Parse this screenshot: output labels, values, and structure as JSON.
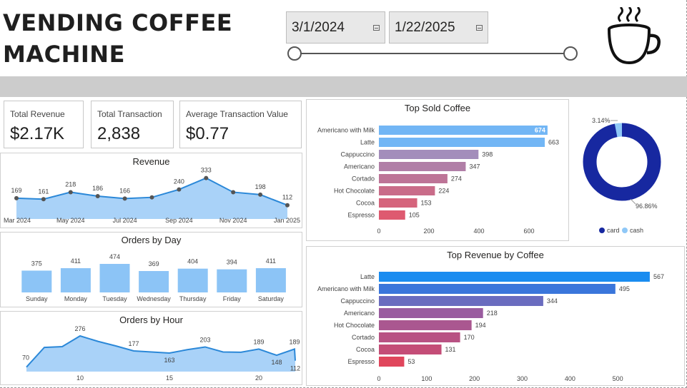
{
  "header": {
    "title_line1": "VENDING COFFEE",
    "title_line2": "MACHINE",
    "date_start": "3/1/2024",
    "date_end": "1/22/2025",
    "icon": "coffee-cup-icon"
  },
  "kpis": {
    "total_revenue_label": "Total Revenue",
    "total_revenue_value": "$2.17K",
    "total_transaction_label": "Total Transaction",
    "total_transaction_value": "2,838",
    "avg_transaction_label": "Average Transaction Value",
    "avg_transaction_value": "$0.77"
  },
  "colors": {
    "area_fill": "#a9d2f8",
    "area_line": "#2b88d8",
    "bar_light": "#8cc4f6",
    "donut_card": "#1728a0",
    "donut_cash": "#8fc8f7"
  },
  "chart_data": [
    {
      "id": "revenue",
      "type": "area",
      "title": "Revenue",
      "x": [
        "Mar 2024",
        "Apr 2024",
        "May 2024",
        "Jun 2024",
        "Jul 2024",
        "Aug 2024",
        "Sep 2024",
        "Oct 2024",
        "Nov 2024",
        "Dec 2024",
        "Jan 2025"
      ],
      "values": [
        169,
        161,
        218,
        186,
        166,
        176,
        240,
        333,
        218,
        198,
        112
      ],
      "data_labels": [
        169,
        161,
        218,
        186,
        166,
        null,
        240,
        333,
        null,
        198,
        112
      ],
      "tick_labels": [
        "Mar 2024",
        "May 2024",
        "Jul 2024",
        "Sep 2024",
        "Nov 2024",
        "Jan 2025"
      ],
      "ylim": [
        0,
        360
      ]
    },
    {
      "id": "orders_by_day",
      "type": "bar",
      "title": "Orders by Day",
      "categories": [
        "Sunday",
        "Monday",
        "Tuesday",
        "Wednesday",
        "Thursday",
        "Friday",
        "Saturday"
      ],
      "values": [
        375,
        411,
        474,
        369,
        404,
        394,
        411
      ],
      "ylim": [
        0,
        500
      ]
    },
    {
      "id": "orders_by_hour",
      "type": "area",
      "title": "Orders by Hour",
      "x": [
        7,
        8,
        9,
        10,
        11,
        12,
        13,
        14,
        15,
        16,
        17,
        18,
        19,
        20,
        21,
        22
      ],
      "values": [
        70,
        200,
        205,
        276,
        240,
        210,
        177,
        170,
        163,
        185,
        203,
        170,
        168,
        189,
        148,
        189
      ],
      "end_value": 112,
      "data_labels": [
        70,
        null,
        null,
        276,
        null,
        null,
        177,
        null,
        163,
        null,
        203,
        null,
        null,
        189,
        148,
        189
      ],
      "tick_labels": [
        "10",
        "15",
        "20"
      ],
      "ylim": [
        0,
        290
      ]
    },
    {
      "id": "top_sold_coffee",
      "type": "bar",
      "orientation": "horizontal",
      "title": "Top Sold Coffee",
      "categories": [
        "Americano with Milk",
        "Latte",
        "Cappuccino",
        "Americano",
        "Cortado",
        "Hot Chocolate",
        "Cocoa",
        "Espresso"
      ],
      "values": [
        674,
        663,
        398,
        347,
        274,
        224,
        153,
        105
      ],
      "bar_colors": [
        "#72b6f5",
        "#72b6f5",
        "#a38dbb",
        "#b17fa7",
        "#bd7497",
        "#c96c89",
        "#d5647c",
        "#de5a70"
      ],
      "ticks": [
        0,
        200,
        400,
        600
      ],
      "xlim": [
        0,
        700
      ]
    },
    {
      "id": "payment_split",
      "type": "pie",
      "donut": true,
      "categories": [
        "card",
        "cash"
      ],
      "values": [
        96.86,
        3.14
      ],
      "data_labels": [
        "96.86%",
        "3.14%"
      ],
      "colors": [
        "#1728a0",
        "#8fc8f7"
      ],
      "legend_position": "bottom"
    },
    {
      "id": "top_revenue_by_coffee",
      "type": "bar",
      "orientation": "horizontal",
      "title": "Top Revenue by Coffee",
      "categories": [
        "Latte",
        "Americano with Milk",
        "Cappuccino",
        "Americano",
        "Hot Chocolate",
        "Cortado",
        "Cocoa",
        "Espresso"
      ],
      "values": [
        567,
        495,
        344,
        218,
        194,
        170,
        131,
        53
      ],
      "bar_colors": [
        "#1a8cf0",
        "#3a76db",
        "#6a6cbf",
        "#9a5c9f",
        "#aa5790",
        "#b85283",
        "#c44d77",
        "#e0465c"
      ],
      "ticks": [
        0,
        100,
        200,
        300,
        400,
        500
      ],
      "xlim": [
        0,
        600
      ]
    }
  ]
}
